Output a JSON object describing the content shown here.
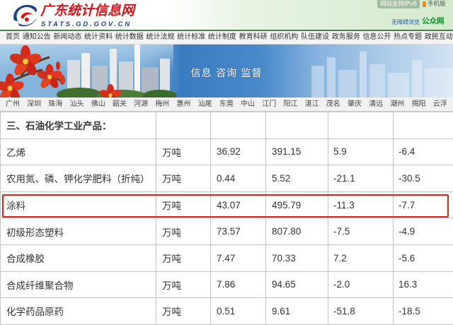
{
  "header": {
    "logo_title": "广东统计信息网",
    "logo_domain": "STATS.GD.GOV.CN",
    "ipv6_label": "网站支持IPv6",
    "mobile_label": "手机版",
    "accessibility_label": "无障碍浏览",
    "public_net_label": "公众网"
  },
  "nav": {
    "items": [
      "首页",
      "通知公告",
      "新闻动态",
      "统计资料",
      "统计数据",
      "统计法规",
      "统计标准",
      "统计制度",
      "教育科研",
      "组织机构",
      "队伍建设",
      "政务服务",
      "信息公开",
      "热点专题",
      "政民互动"
    ]
  },
  "banner": {
    "slogan": "信息 咨询 监督"
  },
  "cities": {
    "items": [
      "广州",
      "深圳",
      "珠海",
      "汕头",
      "佛山",
      "韶关",
      "河源",
      "梅州",
      "惠州",
      "汕尾",
      "东莞",
      "中山",
      "江门",
      "阳江",
      "湛江",
      "茂名",
      "肇庆",
      "清远",
      "潮州",
      "揭阳",
      "云浮"
    ]
  },
  "table": {
    "section_title": "三、石油化学工业产品：",
    "rows": [
      {
        "name": "乙烯",
        "unit": "万吨",
        "c1": "36.92",
        "c2": "391.15",
        "c3": "5.9",
        "c4": "-6.4"
      },
      {
        "name": "农用氮、磷、钾化学肥料（折纯）",
        "unit": "万吨",
        "c1": "0.44",
        "c2": "5.52",
        "c3": "-21.1",
        "c4": "-30.5"
      },
      {
        "name": "涂料",
        "unit": "万吨",
        "c1": "43.07",
        "c2": "495.79",
        "c3": "-11.3",
        "c4": "-7.7"
      },
      {
        "name": "初级形态塑料",
        "unit": "万吨",
        "c1": "73.57",
        "c2": "807.80",
        "c3": "-7.5",
        "c4": "-4.9"
      },
      {
        "name": "合成橡胶",
        "unit": "万吨",
        "c1": "7.47",
        "c2": "70.33",
        "c3": "7.2",
        "c4": "-5.6"
      },
      {
        "name": "合成纤维聚合物",
        "unit": "万吨",
        "c1": "7.86",
        "c2": "94.65",
        "c3": "-2.0",
        "c4": "16.3"
      },
      {
        "name": "化学药品原药",
        "unit": "万吨",
        "c1": "0.51",
        "c2": "9.61",
        "c3": "-51.8",
        "c4": "-18.5"
      }
    ],
    "highlighted_row": 2
  },
  "colors": {
    "logo_red": "#d5121a",
    "logo_blue": "#1d3f8f",
    "public_net_green": "#0b8a2c",
    "highlight_border": "#e0201c",
    "table_border": "#c4c4c4"
  },
  "icons": {
    "logo": "swirl-logo-icon",
    "mobile": "phone-icon"
  }
}
